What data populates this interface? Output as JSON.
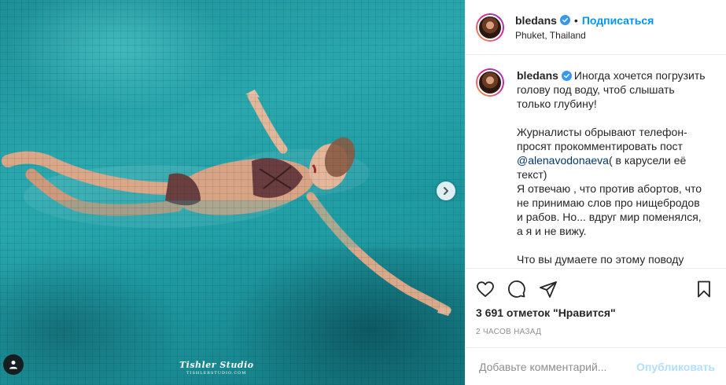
{
  "header": {
    "username": "bledans",
    "separator": "•",
    "follow_label": "Подписаться",
    "location": "Phuket, Thailand"
  },
  "caption": {
    "username": "bledans",
    "p1_line1": "Иногда хочется погрузить",
    "p1_line2": "голову под воду, чтоб слышать",
    "p1_line3": "только глубину!",
    "p2_line1": "Журналисты обрывают телефон-",
    "p2_line2": "просят прокомментировать пост",
    "p2_mention": "@alenavodonaeva",
    "p2_line3_rest": "( в карусели её",
    "p2_line4": "текст)",
    "p3_line1": "Я отвечаю , что против абортов, что",
    "p3_line2": "не принимаю слов про нищебродов",
    "p3_line3": "и рабов. Но... вдруг мир поменялся,",
    "p3_line4": "а я и не вижу.",
    "p4_line1": "Что вы думаете по этому поводу"
  },
  "stats": {
    "likes": "3 691 отметок \"Нравится\"",
    "time": "2 ЧАСОВ НАЗАД"
  },
  "comment": {
    "placeholder": "Добавьте комментарий...",
    "publish_label": "Опубликовать"
  },
  "media": {
    "watermark_main": "Tishler Studio",
    "watermark_sub": "TISHLERSTUDIO.COM"
  },
  "colors": {
    "accent": "#0095f6",
    "publish_disabled": "#b2dffc",
    "verified": "#3897f0",
    "water": "#1f9aa2"
  },
  "icons": [
    "verified-badge-icon",
    "heart-icon",
    "comment-icon",
    "share-icon",
    "bookmark-icon",
    "chevron-right-icon",
    "user-tag-icon"
  ]
}
